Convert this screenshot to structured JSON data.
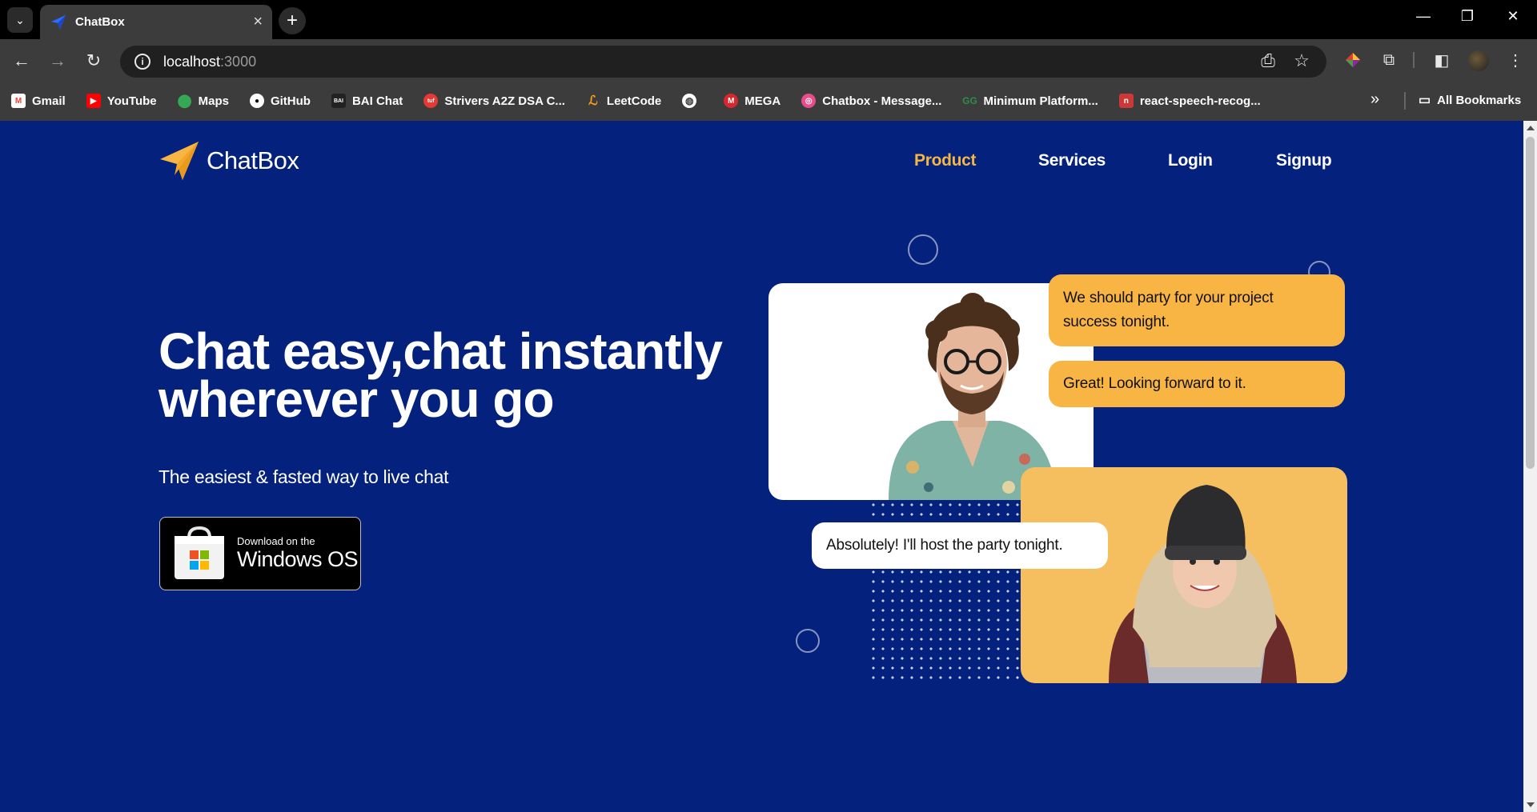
{
  "browser": {
    "tab": {
      "title": "ChatBox"
    },
    "address_bar": {
      "host": "localhost",
      "port": ":3000"
    },
    "bookmarks": [
      {
        "label": "Gmail",
        "icon": "gmail-icon",
        "color": "#ea4335"
      },
      {
        "label": "YouTube",
        "icon": "youtube-icon",
        "color": "#ff0000"
      },
      {
        "label": "Maps",
        "icon": "maps-icon",
        "color": "#34a853"
      },
      {
        "label": "GitHub",
        "icon": "github-icon",
        "color": "#ffffff"
      },
      {
        "label": "BAI Chat",
        "icon": "bai-chat-icon",
        "color": "#222222"
      },
      {
        "label": "Strivers A2Z DSA C...",
        "icon": "tuf-icon",
        "color": "#e53935"
      },
      {
        "label": "LeetCode",
        "icon": "leetcode-icon",
        "color": "#f89f1b"
      },
      {
        "label": "",
        "icon": "globe-icon",
        "color": "#ffffff"
      },
      {
        "label": "MEGA",
        "icon": "mega-icon",
        "color": "#d9272e"
      },
      {
        "label": "Chatbox - Message...",
        "icon": "dribbble-icon",
        "color": "#ea4c89"
      },
      {
        "label": "Minimum Platform...",
        "icon": "gfg-icon",
        "color": "#2f8d46"
      },
      {
        "label": "react-speech-recog...",
        "icon": "npm-icon",
        "color": "#cb3837"
      }
    ],
    "all_bookmarks": "All Bookmarks"
  },
  "site": {
    "brand": "ChatBox",
    "nav": [
      "Product",
      "Services",
      "Login",
      "Signup"
    ],
    "hero": {
      "title_line1": "Chat easy,chat instantly",
      "title_line2": "wherever you go",
      "subtitle": "The easiest & fasted way to live chat"
    },
    "store_button": {
      "small": "Download on the",
      "big": "Windows OS"
    },
    "chat": {
      "bubble1": "We should party for your project success tonight.",
      "bubble2": "Great! Looking forward to it.",
      "bubble3": "Absolutely! I'll host the party tonight."
    }
  },
  "colors": {
    "page_bg": "#03217d",
    "accent": "#f5b642",
    "bubble_orange": "#f9b544",
    "card_orange": "#f5be5e"
  }
}
